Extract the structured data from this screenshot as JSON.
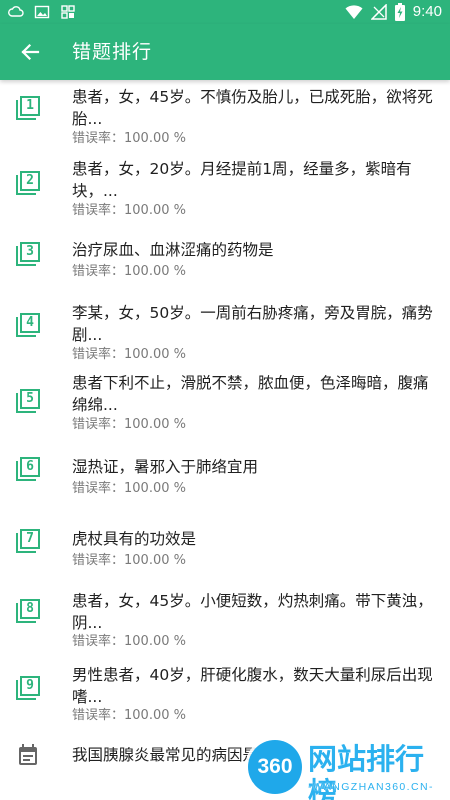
{
  "status_bar": {
    "time": "9:40",
    "left_icons": [
      "cloud-icon",
      "image-icon",
      "grid-icon"
    ],
    "right_icons": [
      "wifi-icon",
      "signal-icon",
      "battery-charging-icon"
    ],
    "color": "#2db47c"
  },
  "app_bar": {
    "title": "错题排行",
    "back_icon": "arrow-left-icon",
    "color": "#2db47c"
  },
  "items": [
    {
      "rank": "1",
      "question": "患者，女，45岁。不慎伤及胎儿，已成死胎，欲将死胎...",
      "rate": "错误率：100.00 %"
    },
    {
      "rank": "2",
      "question": "患者，女，20岁。月经提前1周，经量多，紫暗有块，...",
      "rate": "错误率：100.00 %"
    },
    {
      "rank": "3",
      "question": "治疗尿血、血淋涩痛的药物是",
      "rate": "错误率：100.00 %"
    },
    {
      "rank": "4",
      "question": "李某，女，50岁。一周前右胁疼痛，旁及胃脘，痛势剧...",
      "rate": "错误率：100.00 %"
    },
    {
      "rank": "5",
      "question": "患者下利不止，滑脱不禁，脓血便，色泽晦暗，腹痛绵绵...",
      "rate": "错误率：100.00 %"
    },
    {
      "rank": "6",
      "question": "湿热证，暑邪入于肺络宜用",
      "rate": "错误率：100.00 %"
    },
    {
      "rank": "7",
      "question": "虎杖具有的功效是",
      "rate": "错误率：100.00 %"
    },
    {
      "rank": "8",
      "question": "患者，女，45岁。小便短数，灼热刺痛。带下黄浊，阴...",
      "rate": "错误率：100.00 %"
    },
    {
      "rank": "9",
      "question": "男性患者，40岁，肝硬化腹水，数天大量利尿后出现嗜...",
      "rate": "错误率：100.00 %"
    },
    {
      "rank_icon": "calendar-icon",
      "question": "我国胰腺炎最常见的病因是",
      "rate": ""
    }
  ],
  "watermark": {
    "badge": "360",
    "title": "网站排行榜",
    "subtitle": "-WANGZHAN360.CN-"
  }
}
